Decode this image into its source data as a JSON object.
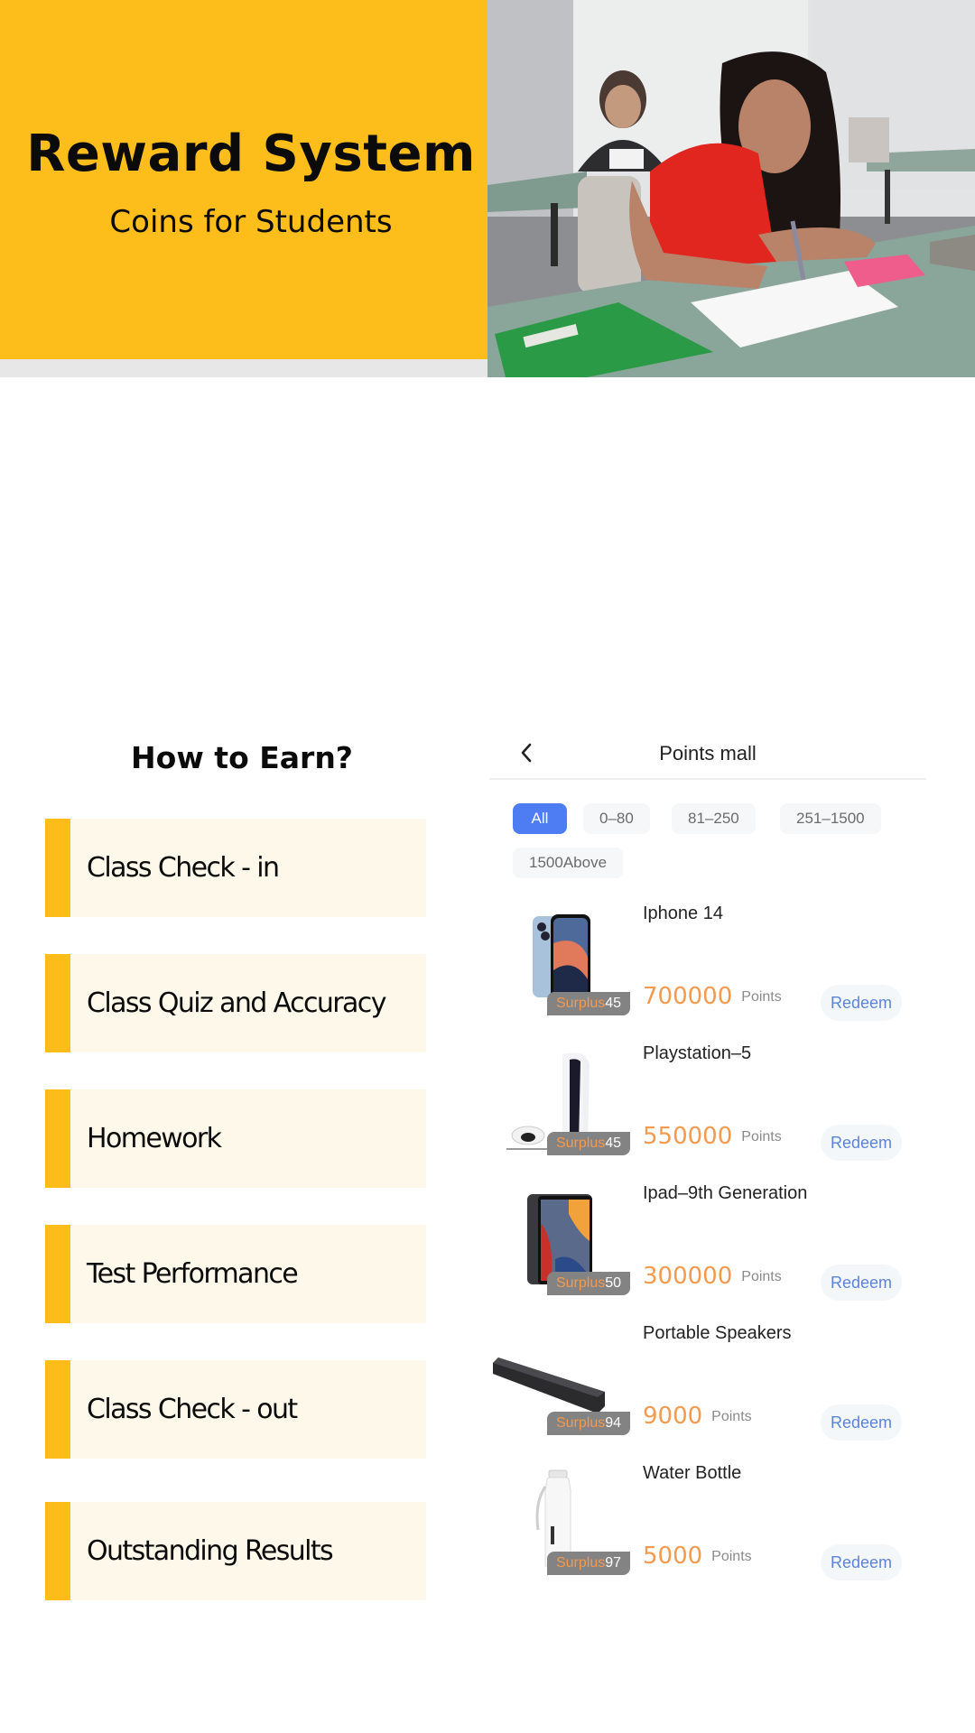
{
  "hero": {
    "title": "Reward System",
    "subtitle": "Coins for Students",
    "photo_alt": "Student writing at desk in classroom"
  },
  "earn": {
    "title": "How to Earn?",
    "items": [
      {
        "label": "Class Check - in"
      },
      {
        "label": "Class Quiz and Accuracy"
      },
      {
        "label": "Homework"
      },
      {
        "label": "Test Performance"
      },
      {
        "label": "Class Check - out"
      },
      {
        "label": "Outstanding Results"
      }
    ]
  },
  "mall": {
    "title": "Points mall",
    "back_icon": "chevron-left-icon",
    "filters": [
      {
        "label": "All",
        "active": true
      },
      {
        "label": "0–80",
        "active": false
      },
      {
        "label": "81–250",
        "active": false
      },
      {
        "label": "251–1500",
        "active": false
      },
      {
        "label": "1500Above",
        "active": false
      }
    ],
    "points_unit": "Points",
    "redeem_label": "Redeem",
    "surplus_label": "Surplus",
    "products": [
      {
        "name": "Iphone 14",
        "points": "700000",
        "surplus": "45",
        "image": "iphone"
      },
      {
        "name": "Playstation–5",
        "points": "550000",
        "surplus": "45",
        "image": "playstation"
      },
      {
        "name": "Ipad–9th Generation",
        "points": "300000",
        "surplus": "50",
        "image": "ipad"
      },
      {
        "name": "Portable Speakers",
        "points": "9000",
        "surplus": "94",
        "image": "speaker"
      },
      {
        "name": "Water Bottle",
        "points": "5000",
        "surplus": "97",
        "image": "bottle"
      }
    ]
  },
  "colors": {
    "brand_yellow": "#fdbd1b",
    "card_bg": "#fef8ea",
    "accent_blue": "#4d7cf3",
    "price_orange": "#f39a4f",
    "redeem_text": "#5b84d8"
  }
}
